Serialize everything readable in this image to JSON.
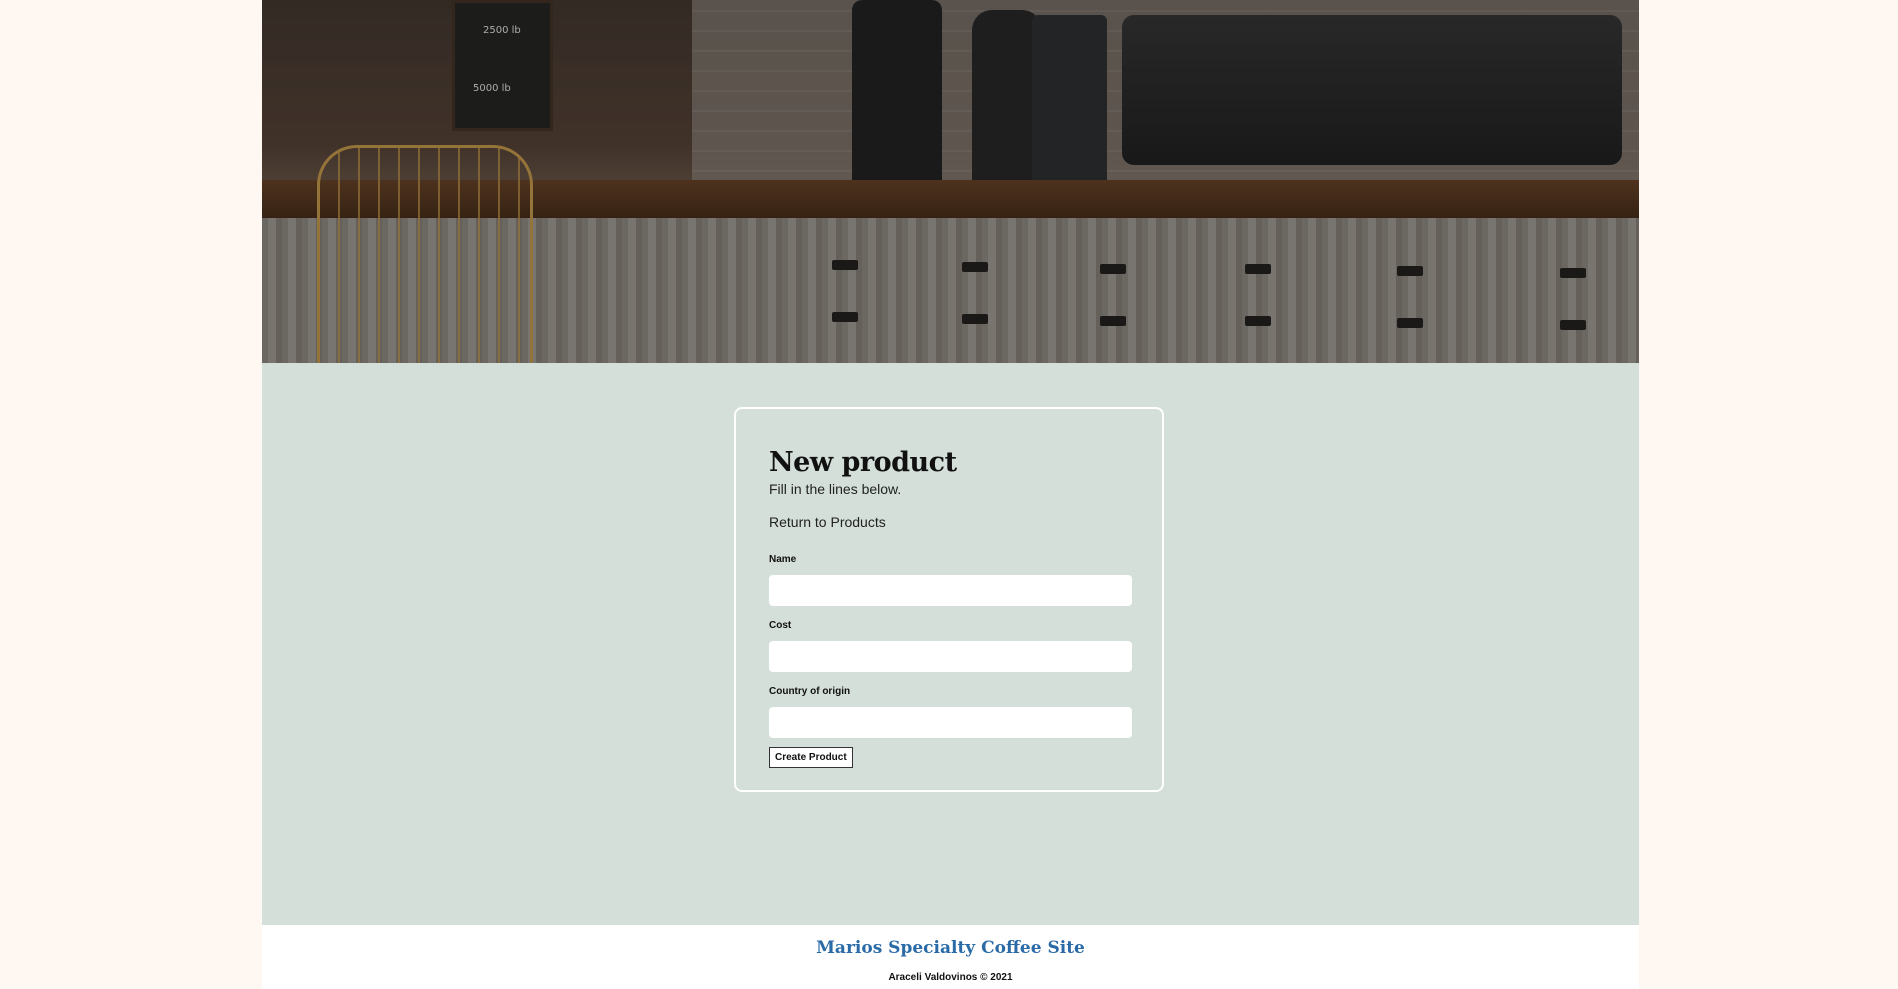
{
  "hero": {
    "image_description_icon": "coffee-shop-counter-image",
    "chalkboard_lines": [
      "2500 lb",
      "5000 lb"
    ]
  },
  "form": {
    "title": "New product",
    "subtitle": "Fill in the lines below.",
    "return_link": "Return to Products",
    "fields": [
      {
        "label": "Name",
        "value": "",
        "placeholder": ""
      },
      {
        "label": "Cost",
        "value": "",
        "placeholder": ""
      },
      {
        "label": "Country of origin",
        "value": "",
        "placeholder": ""
      }
    ],
    "submit_label": "Create Product"
  },
  "footer": {
    "site_name": "Marios Specialty Coffee Site",
    "copyright": "Araceli Valdovinos © 2021"
  },
  "colors": {
    "page_background": "#fff8f2",
    "main_background": "#d4dfd9",
    "footer_link": "#2a6aa7",
    "card_border": "#ffffff"
  }
}
